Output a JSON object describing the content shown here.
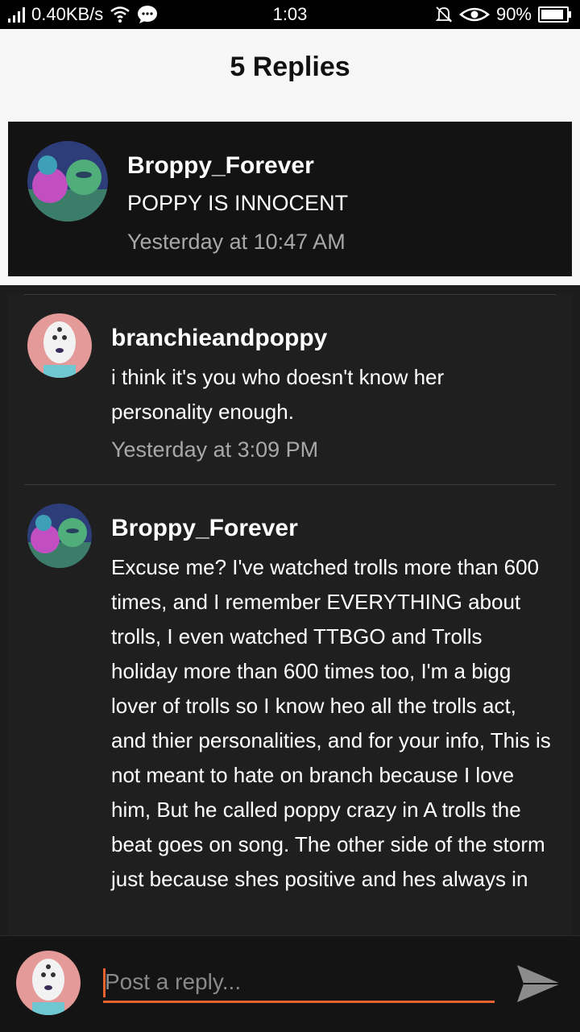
{
  "status_bar": {
    "speed": "0.40KB/s",
    "time": "1:03",
    "battery": "90%",
    "battery_level": 0.9,
    "icons": [
      "signal-icon",
      "wifi-icon",
      "message-icon",
      "mute-bell-icon",
      "eye-icon",
      "battery-icon"
    ]
  },
  "header": {
    "title": "5 Replies"
  },
  "parent": {
    "username": "Broppy_Forever",
    "text": "POPPY IS INNOCENT",
    "time": "Yesterday at 10:47 AM"
  },
  "replies": [
    {
      "username": "branchieandpoppy",
      "text": "i think it's you who doesn't know her personality enough.",
      "time": "Yesterday at 3:09 PM"
    },
    {
      "username": "Broppy_Forever",
      "text": "Excuse me? I've watched trolls more than 600 times, and I remember EVERYTHING about trolls, I even watched TTBGO and Trolls holiday more than 600 times too, I'm a bigg lover of trolls so I know heo all the trolls act, and thier personalities, and for your info, This is not meant to hate on branch because I love him, But he called poppy crazy in A trolls the beat goes on song. The other side of the storm just because shes positive and hes always in"
    }
  ],
  "composer": {
    "placeholder": "Post a reply..."
  },
  "colors": {
    "accent": "#e8622e"
  }
}
